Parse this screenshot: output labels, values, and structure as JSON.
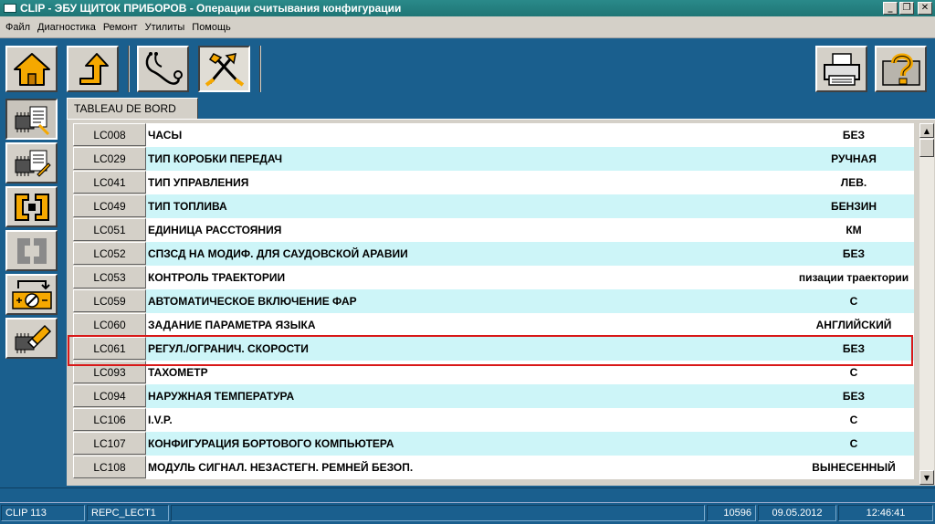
{
  "window": {
    "title": "CLIP - ЭБУ ЩИТОК ПРИБОРОВ - Операции считывания конфигурации",
    "minimize_glyph": "_",
    "restore_glyph": "❐",
    "close_glyph": "✕"
  },
  "menu": [
    "Файл",
    "Диагностика",
    "Ремонт",
    "Утилиты",
    "Помощь"
  ],
  "toolbar": {
    "home_icon": "home-icon",
    "up_icon": "up-arrow-icon",
    "diagnostic_icon": "stethoscope-icon",
    "repair_icon": "tools-icon",
    "print_icon": "printer-icon",
    "help_icon": "help-icon"
  },
  "tab": {
    "label": "TABLEAU DE BORD"
  },
  "rows": [
    {
      "code": "LC008",
      "name": "ЧАСЫ",
      "value": "БЕЗ"
    },
    {
      "code": "LC029",
      "name": "ТИП КОРОБКИ ПЕРЕДАЧ",
      "value": "РУЧНАЯ"
    },
    {
      "code": "LC041",
      "name": "ТИП УПРАВЛЕНИЯ",
      "value": "ЛЕВ."
    },
    {
      "code": "LC049",
      "name": "ТИП ТОПЛИВА",
      "value": "БЕНЗИН"
    },
    {
      "code": "LC051",
      "name": "ЕДИНИЦА РАССТОЯНИЯ",
      "value": "КМ"
    },
    {
      "code": "LC052",
      "name": "СПЗСД НА МОДИФ. ДЛЯ САУДОВСКОЙ АРАВИИ",
      "value": "БЕЗ"
    },
    {
      "code": "LC053",
      "name": "КОНТРОЛЬ ТРАЕКТОРИИ",
      "value": "пизации траектории"
    },
    {
      "code": "LC059",
      "name": "АВТОМАТИЧЕСКОЕ ВКЛЮЧЕНИЕ ФАР",
      "value": "С"
    },
    {
      "code": "LC060",
      "name": "ЗАДАНИЕ ПАРАМЕТРА ЯЗЫКА",
      "value": "АНГЛИЙСКИЙ"
    },
    {
      "code": "LC061",
      "name": "РЕГУЛ./ОГРАНИЧ. СКОРОСТИ",
      "value": "БЕЗ"
    },
    {
      "code": "LC093",
      "name": "ТАХОМЕТР",
      "value": "С"
    },
    {
      "code": "LC094",
      "name": "НАРУЖНАЯ ТЕМПЕРАТУРА",
      "value": "БЕЗ"
    },
    {
      "code": "LC106",
      "name": "I.V.P.",
      "value": "С"
    },
    {
      "code": "LC107",
      "name": "КОНФИГУРАЦИЯ БОРТОВОГО КОМПЬЮТЕРА",
      "value": "С"
    },
    {
      "code": "LC108",
      "name": "МОДУЛЬ СИГНАЛ. НЕЗАСТЕГН. РЕМНЕЙ БЕЗОП.",
      "value": "ВЫНЕСЕННЫЙ"
    }
  ],
  "highlighted_code": "LC061",
  "scrollbar": {
    "up_glyph": "▲",
    "down_glyph": "▼"
  },
  "status": {
    "clip": "CLIP 113",
    "mode": "REPC_LECT1",
    "empty1": "",
    "number": "10596",
    "date": "09.05.2012",
    "time": "12:46:41"
  }
}
